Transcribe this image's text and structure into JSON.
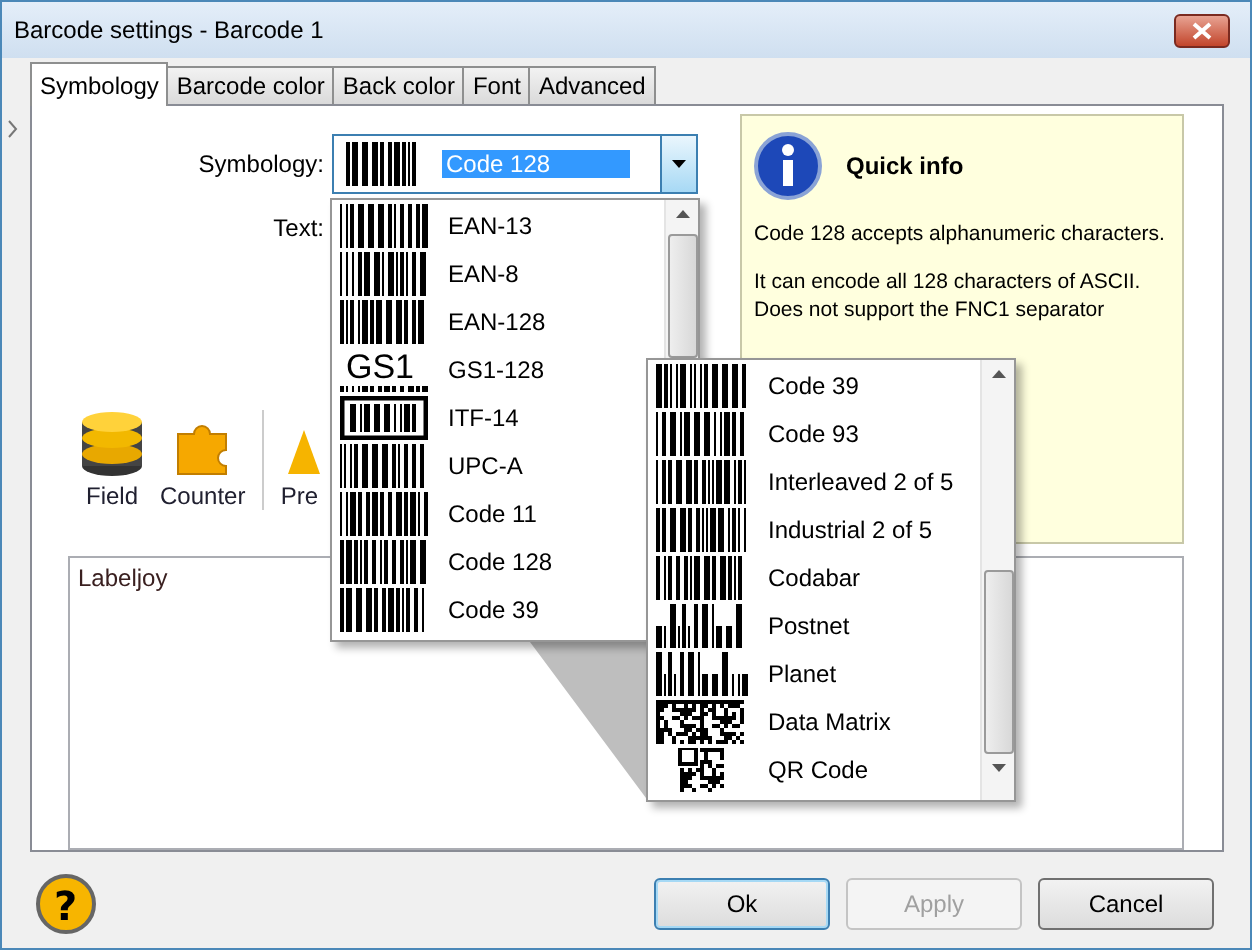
{
  "window": {
    "title": "Barcode settings - Barcode 1"
  },
  "tabs": [
    {
      "label": "Symbology",
      "selected": true
    },
    {
      "label": "Barcode color",
      "selected": false
    },
    {
      "label": "Back color",
      "selected": false
    },
    {
      "label": "Font",
      "selected": false
    },
    {
      "label": "Advanced",
      "selected": false
    }
  ],
  "symbology": {
    "label": "Symbology:",
    "value": "Code 128"
  },
  "text_field": {
    "label": "Text:"
  },
  "dropdown": {
    "items": [
      {
        "label": "EAN-13",
        "kind": "linear"
      },
      {
        "label": "EAN-8",
        "kind": "linear"
      },
      {
        "label": "EAN-128",
        "kind": "linear"
      },
      {
        "label": "GS1-128",
        "kind": "gs1",
        "icon_text": "GS1"
      },
      {
        "label": "ITF-14",
        "kind": "framed"
      },
      {
        "label": "UPC-A",
        "kind": "linear"
      },
      {
        "label": "Code 11",
        "kind": "linear"
      },
      {
        "label": "Code 128",
        "kind": "linear"
      },
      {
        "label": "Code 39",
        "kind": "linear"
      }
    ]
  },
  "quick_info": {
    "title": "Quick info",
    "paragraphs": [
      "Code 128 accepts alphanumeric characters.",
      "It can encode all 128 characters of ASCII. Does not support the FNC1 separator"
    ]
  },
  "toolbar": [
    {
      "label": "Field",
      "kind": "database"
    },
    {
      "label": "Counter",
      "kind": "puzzle"
    },
    {
      "label": "Pre",
      "kind": "other"
    }
  ],
  "text_area": {
    "value": "Labeljoy"
  },
  "magnified_list": {
    "items": [
      {
        "label": "Code 39",
        "kind": "linear"
      },
      {
        "label": "Code 93",
        "kind": "linear"
      },
      {
        "label": "Interleaved 2 of 5",
        "kind": "linear"
      },
      {
        "label": "Industrial 2 of 5",
        "kind": "linear"
      },
      {
        "label": "Codabar",
        "kind": "linear"
      },
      {
        "label": "Postnet",
        "kind": "postal"
      },
      {
        "label": "Planet",
        "kind": "postal"
      },
      {
        "label": "Data Matrix",
        "kind": "matrix"
      },
      {
        "label": "QR Code",
        "kind": "qr"
      }
    ]
  },
  "help": {
    "icon_text": "?"
  },
  "buttons": [
    {
      "label": "Ok",
      "default": true,
      "disabled": false
    },
    {
      "label": "Apply",
      "default": false,
      "disabled": true
    },
    {
      "label": "Cancel",
      "default": false,
      "disabled": false
    }
  ]
}
